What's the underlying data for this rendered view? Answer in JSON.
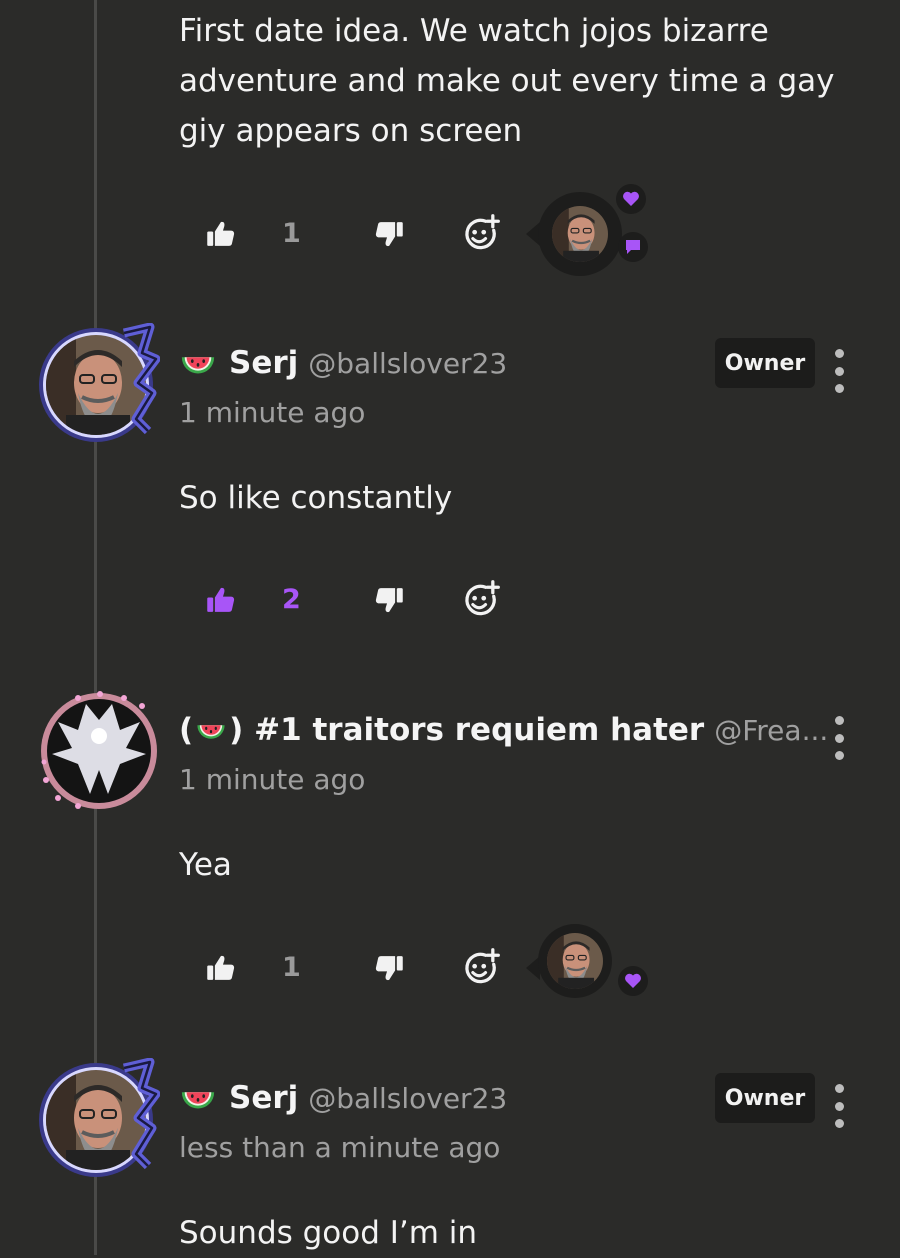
{
  "comments": [
    {
      "text_lines": [
        "First date idea. We watch jojos bizarre",
        "adventure and make out every time a gay",
        "giy appears on screen"
      ],
      "likes": "1",
      "liked": false
    },
    {
      "display_name": "Serj",
      "handle": "@ballslover23",
      "time": "1 minute ago",
      "badge": "Owner",
      "text": "So like constantly",
      "likes": "2",
      "liked": true
    },
    {
      "display_name": "( ) #1 traitors requiem hater",
      "display_name_prefix": "(",
      "display_name_suffix": ") #1 traitors requiem hater",
      "handle": "@Frea...",
      "time": "1 minute ago",
      "text": "Yea",
      "likes": "1",
      "liked": false
    },
    {
      "display_name": "Serj",
      "handle": "@ballslover23",
      "time": "less than a minute ago",
      "badge": "Owner",
      "text": "Sounds good I’m in"
    }
  ],
  "colors": {
    "background": "#2b2b29",
    "accent": "#a855f7",
    "muted": "#a0a0a0"
  },
  "icons": [
    "thumbs-up-icon",
    "thumbs-down-icon",
    "add-reaction-icon",
    "heart-icon",
    "chat-bubble-icon",
    "watermelon-icon",
    "more-vertical-icon"
  ]
}
